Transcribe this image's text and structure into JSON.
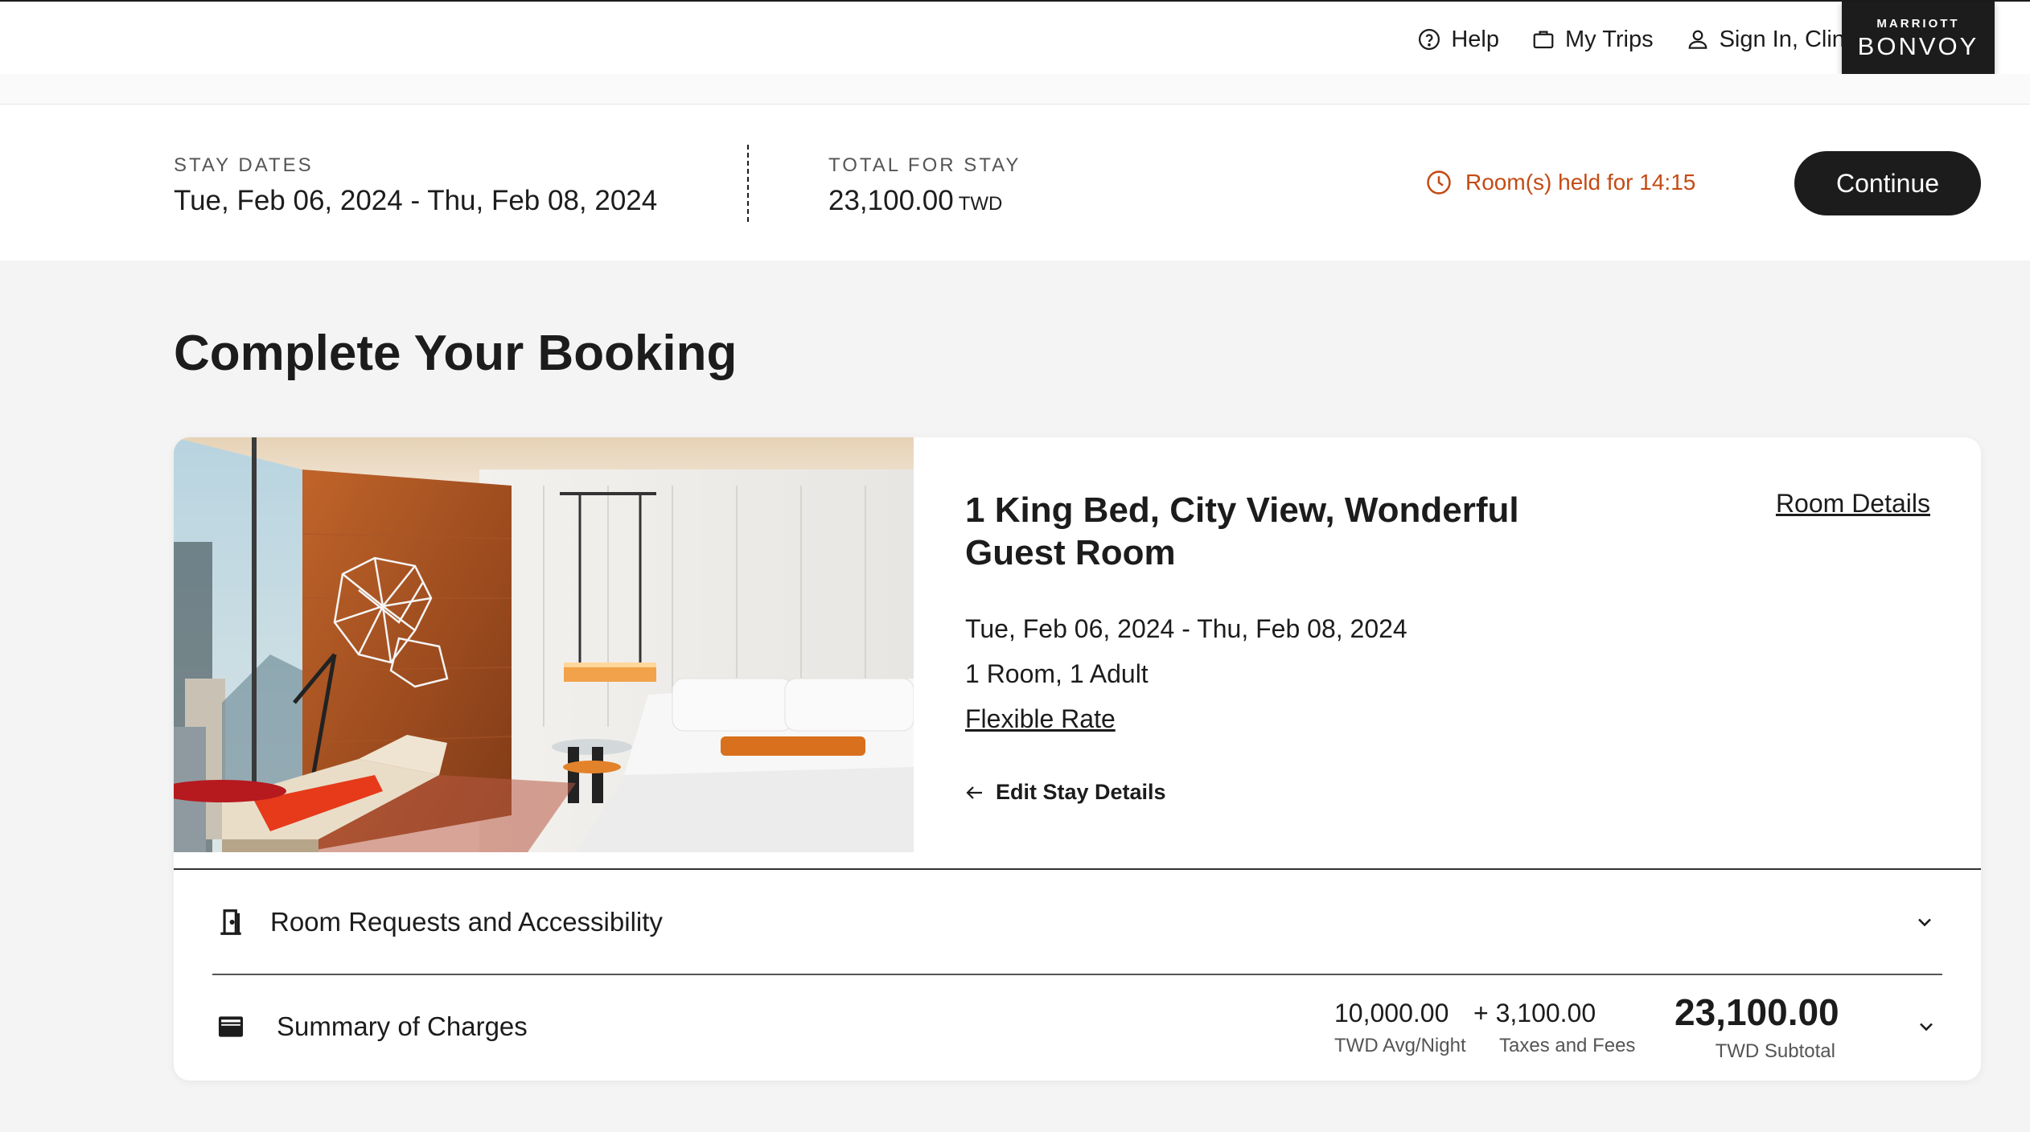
{
  "nav": {
    "help": "Help",
    "trips": "My Trips",
    "signin": "Sign In, Clint",
    "logo_top": "MARRIOTT",
    "logo_main": "BONVOY"
  },
  "stay": {
    "dates_label": "STAY DATES",
    "dates_value": "Tue, Feb 06, 2024 - Thu, Feb 08, 2024",
    "total_label": "TOTAL FOR STAY",
    "total_value": "23,100.00",
    "total_currency": "TWD",
    "held_text": "Room(s) held for 14:15",
    "continue_label": "Continue"
  },
  "page": {
    "title": "Complete Your Booking"
  },
  "room": {
    "title": "1 King Bed, City View, Wonderful Guest Room",
    "details_link": "Room Details",
    "dates": "Tue, Feb 06, 2024 - Thu, Feb 08, 2024",
    "occupancy": "1 Room, 1 Adult",
    "rate": "Flexible Rate",
    "edit_link": "Edit Stay Details"
  },
  "sections": {
    "requests_label": "Room Requests and Accessibility",
    "summary_label": "Summary of Charges"
  },
  "charges": {
    "avg_value": "10,000.00",
    "avg_label": "TWD Avg/Night",
    "taxes_value": "+ 3,100.00",
    "taxes_label": "Taxes and Fees",
    "subtotal_value": "23,100.00",
    "subtotal_label": "TWD Subtotal"
  },
  "colors": {
    "accent_warning": "#c44b14",
    "primary_dark": "#1c1c1c",
    "page_bg": "#f4f4f4"
  },
  "icons": {
    "help": "help-circle-icon",
    "trips": "briefcase-icon",
    "signin": "user-icon",
    "timer": "clock-icon",
    "edit": "arrow-left-icon",
    "requests": "door-icon",
    "summary": "wallet-icon",
    "expand": "chevron-down-icon"
  }
}
